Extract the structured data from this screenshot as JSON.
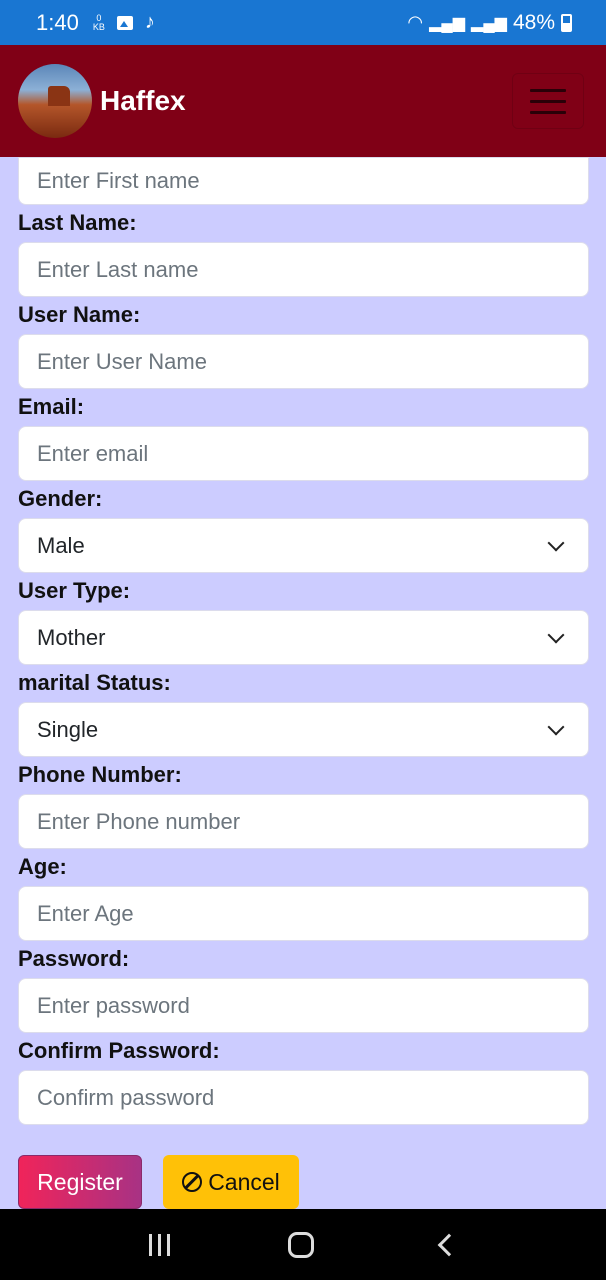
{
  "status": {
    "time": "1:40",
    "kb": "0\nKB",
    "battery": "48%"
  },
  "header": {
    "brand": "Haffex"
  },
  "form": {
    "first_name": {
      "placeholder": "Enter First name"
    },
    "last_name": {
      "label": "Last Name:",
      "placeholder": "Enter Last name"
    },
    "user_name": {
      "label": "User Name:",
      "placeholder": "Enter User Name"
    },
    "email": {
      "label": "Email:",
      "placeholder": "Enter email"
    },
    "gender": {
      "label": "Gender:",
      "value": "Male"
    },
    "user_type": {
      "label": "User Type:",
      "value": "Mother"
    },
    "marital_status": {
      "label": "marital Status:",
      "value": "Single"
    },
    "phone": {
      "label": "Phone Number:",
      "placeholder": "Enter Phone number"
    },
    "age": {
      "label": "Age:",
      "placeholder": "Enter Age"
    },
    "password": {
      "label": "Password:",
      "placeholder": "Enter password"
    },
    "confirm_password": {
      "label": "Confirm Password:",
      "placeholder": "Confirm password"
    }
  },
  "actions": {
    "register": "Register",
    "cancel": "Cancel"
  },
  "colors": {
    "statusbar": "#1976d2",
    "navbar": "#800016",
    "background": "#ccccff",
    "cancel": "#ffc107"
  },
  "icons": {
    "menu": "hamburger-icon",
    "cancel": "ban-icon"
  }
}
